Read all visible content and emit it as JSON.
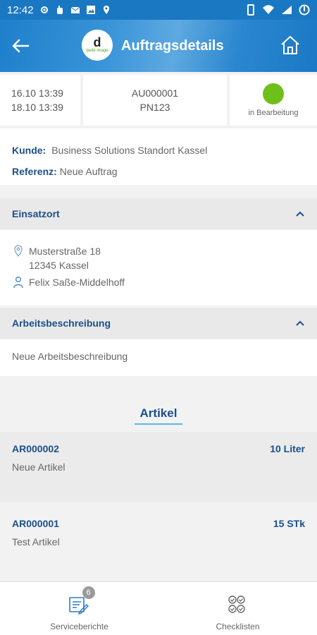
{
  "status_bar": {
    "time": "12:42"
  },
  "header": {
    "title": "Auftragsdetails",
    "logo_letter": "d",
    "logo_text": "pede image"
  },
  "summary": {
    "date_start": "16.10 13:39",
    "date_end": "18.10 13:39",
    "order_number": "AU000001",
    "project_number": "PN123",
    "status_label": "in Bearbeitung",
    "status_color": "#6fbf1a"
  },
  "customer": {
    "kunde_label": "Kunde:",
    "kunde_value": "Business Solutions Standort Kassel",
    "referenz_label": "Referenz:",
    "referenz_value": "Neue Auftrag"
  },
  "einsatzort": {
    "title": "Einsatzort",
    "street": "Musterstraße 18",
    "city": "12345 Kassel",
    "contact": "Felix Saße-Middelhoff"
  },
  "arbeitsbeschreibung": {
    "title": "Arbeitsbeschreibung",
    "text": "Neue Arbeitsbeschreibung"
  },
  "artikel": {
    "title": "Artikel",
    "items": [
      {
        "number": "AR000002",
        "qty": "10 Liter",
        "name": "Neue Artikel"
      },
      {
        "number": "AR000001",
        "qty": "15 STk",
        "name": "Test Artikel"
      }
    ]
  },
  "bottom_nav": {
    "service_label": "Serviceberichte",
    "service_badge": "6",
    "checklist_label": "Checklisten"
  },
  "colors": {
    "primary": "#1a78c2",
    "heading": "#1a4f8b",
    "accent_underline": "#58b8e8"
  }
}
